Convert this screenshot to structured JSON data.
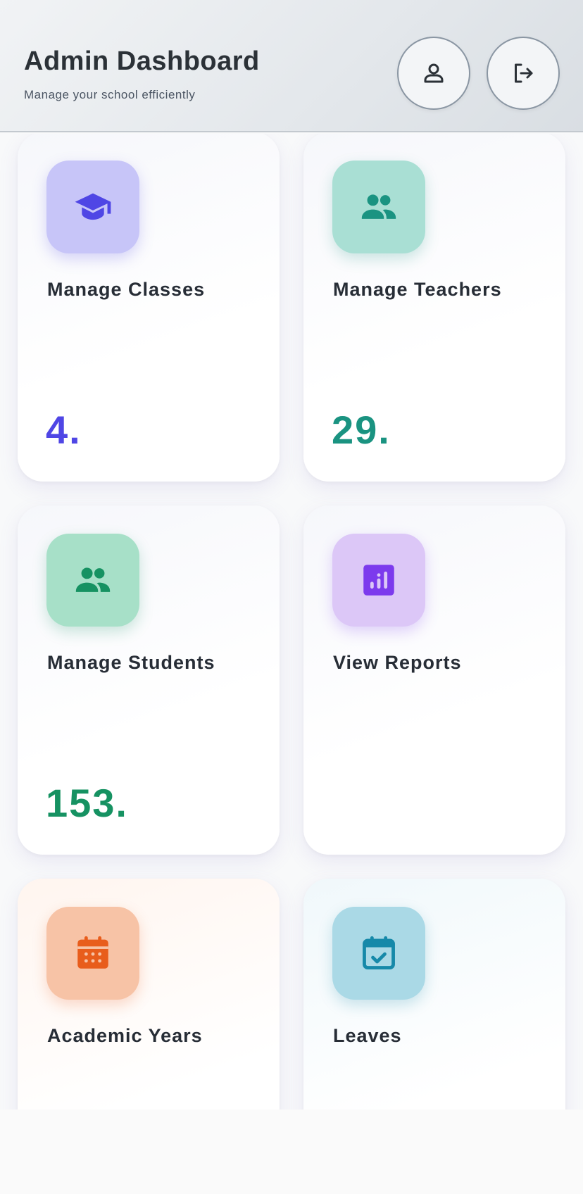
{
  "header": {
    "title": "Admin Dashboard",
    "subtitle": "Manage your school efficiently",
    "profile_icon": "person-icon",
    "logout_icon": "logout-icon"
  },
  "cards": [
    {
      "title": "Manage Classes",
      "count": "4.",
      "icon": "graduation-cap-icon",
      "accent": "#4f46e5",
      "icon_bg": "#c7c5f8"
    },
    {
      "title": "Manage Teachers",
      "count": "29.",
      "icon": "people-icon",
      "accent": "#1a9381",
      "icon_bg": "#a9dfd4"
    },
    {
      "title": "Manage Students",
      "count": "153.",
      "icon": "people-icon",
      "accent": "#169262",
      "icon_bg": "#a7e0c8"
    },
    {
      "title": "View Reports",
      "count": "",
      "icon": "bar-chart-icon",
      "accent": "#7c3aed",
      "icon_bg": "#dcc7f7"
    },
    {
      "title": "Academic Years",
      "count": "",
      "icon": "calendar-icon",
      "accent": "#e85d1c",
      "icon_bg": "#f7c3a6"
    },
    {
      "title": "Leaves",
      "count": "",
      "icon": "calendar-check-icon",
      "accent": "#1689a9",
      "icon_bg": "#aad9e6"
    }
  ]
}
